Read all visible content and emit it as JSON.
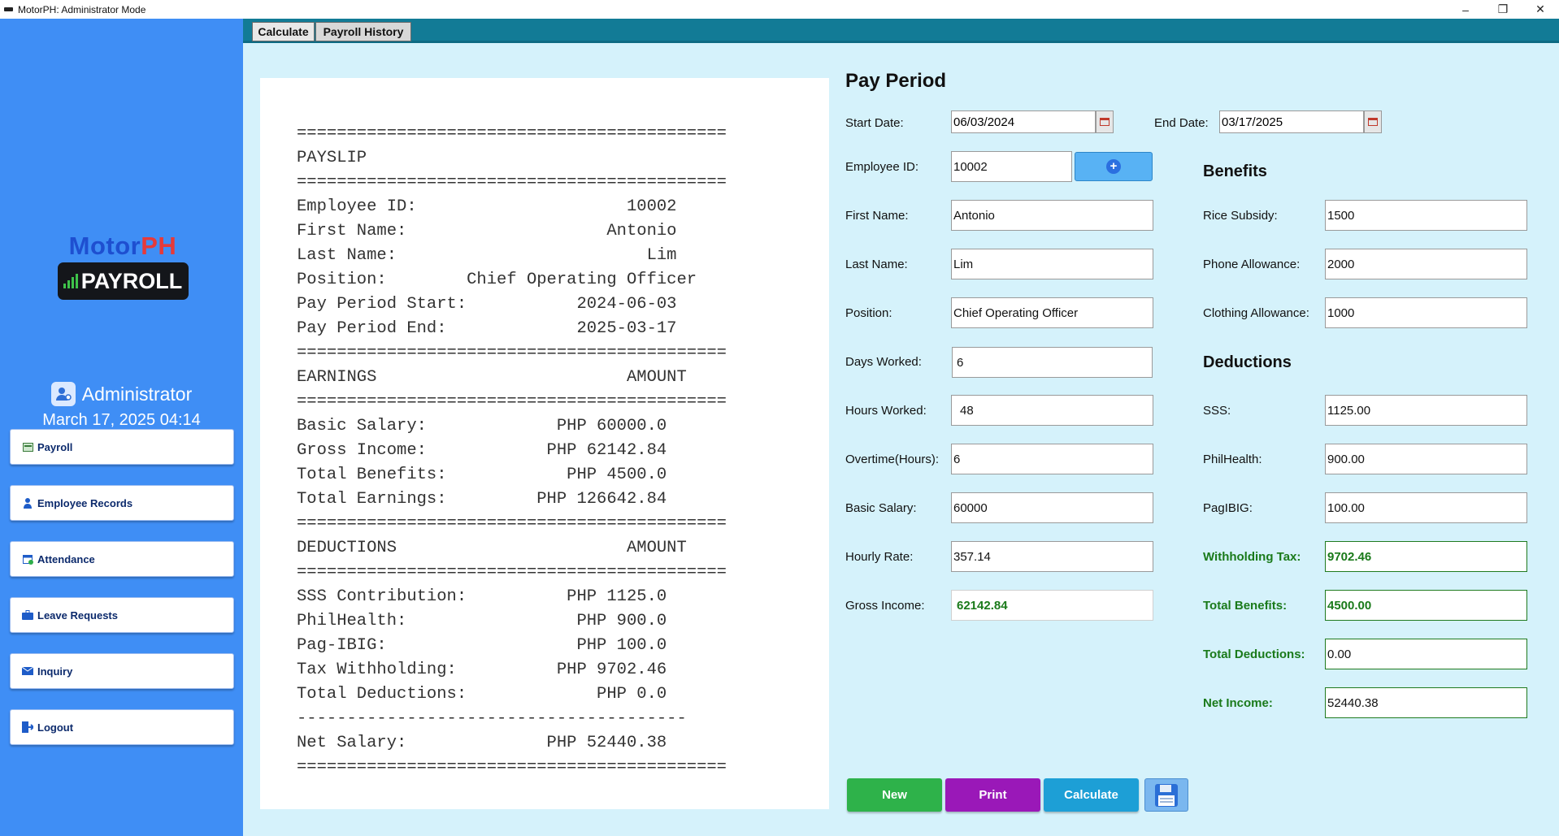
{
  "window": {
    "title": "MotorPH: Administrator Mode",
    "controls": {
      "minimize": "–",
      "restore": "❐",
      "close": "✕"
    }
  },
  "sidebar": {
    "logo_motor": "Motor",
    "logo_ph": "PH",
    "logo_payroll": "PAYROLL",
    "admin_name": "Administrator",
    "datetime": "March 17, 2025 04:14",
    "buttons": [
      {
        "label": "Payroll",
        "icon": "payroll-icon"
      },
      {
        "label": "Employee Records",
        "icon": "person-icon"
      },
      {
        "label": "Attendance",
        "icon": "calendar-check-icon"
      },
      {
        "label": "Leave Requests",
        "icon": "briefcase-icon"
      },
      {
        "label": "Inquiry",
        "icon": "mail-icon"
      },
      {
        "label": "Logout",
        "icon": "logout-icon"
      }
    ]
  },
  "tabs": [
    {
      "label": "Calculate",
      "active": true
    },
    {
      "label": "Payroll History",
      "active": false
    }
  ],
  "payslip": {
    "lines": [
      "===========================================",
      "PAYSLIP",
      "===========================================",
      "Employee ID:                     10002",
      "First Name:                    Antonio",
      "Last Name:                         Lim",
      "Position:        Chief Operating Officer",
      "Pay Period Start:           2024-06-03",
      "Pay Period End:             2025-03-17",
      "===========================================",
      "EARNINGS                         AMOUNT",
      "===========================================",
      "Basic Salary:             PHP 60000.0",
      "Gross Income:            PHP 62142.84",
      "Total Benefits:            PHP 4500.0",
      "Total Earnings:         PHP 126642.84",
      "===========================================",
      "DEDUCTIONS                       AMOUNT",
      "===========================================",
      "SSS Contribution:          PHP 1125.0",
      "PhilHealth:                 PHP 900.0",
      "Pag-IBIG:                   PHP 100.0",
      "Tax Withholding:          PHP 9702.46",
      "Total Deductions:             PHP 0.0",
      "---------------------------------------",
      "Net Salary:              PHP 52440.38",
      "==========================================="
    ]
  },
  "form": {
    "pay_period_title": "Pay Period",
    "start_date_label": "Start Date:",
    "start_date": "06/03/2024",
    "end_date_label": "End Date:",
    "end_date": "03/17/2025",
    "employee_id_label": "Employee ID:",
    "employee_id": "10002",
    "first_name_label": "First Name:",
    "first_name": "Antonio",
    "last_name_label": "Last Name:",
    "last_name": "Lim",
    "position_label": "Position:",
    "position": "Chief Operating Officer",
    "days_worked_label": "Days Worked:",
    "days_worked": "6",
    "hours_worked_label": "Hours Worked:",
    "hours_worked": "48",
    "overtime_label": "Overtime(Hours):",
    "overtime": "6",
    "basic_salary_label": "Basic Salary:",
    "basic_salary": "60000",
    "hourly_rate_label": "Hourly Rate:",
    "hourly_rate": "357.14",
    "gross_income_label": "Gross Income:",
    "gross_income": "62142.84"
  },
  "benefits": {
    "title": "Benefits",
    "rice_label": "Rice Subsidy:",
    "rice": "1500",
    "phone_label": "Phone Allowance:",
    "phone": "2000",
    "clothing_label": "Clothing Allowance:",
    "clothing": "1000"
  },
  "deductions": {
    "title": "Deductions",
    "sss_label": "SSS:",
    "sss": "1125.00",
    "philhealth_label": "PhilHealth:",
    "philhealth": "900.00",
    "pagibig_label": "PagIBIG:",
    "pagibig": "100.00",
    "withholding_label": "Withholding Tax:",
    "withholding": "9702.46",
    "total_benefits_label": "Total Benefits:",
    "total_benefits": "4500.00",
    "total_deductions_label": "Total Deductions:",
    "total_deductions": "0.00",
    "net_income_label": "Net Income:",
    "net_income": "52440.38"
  },
  "actions": {
    "new": "New",
    "print": "Print",
    "calculate": "Calculate"
  },
  "colors": {
    "sidebar": "#3f8ef5",
    "tabbar": "#127b96",
    "background": "#d5f2fb",
    "new_button": "#2eb24a",
    "print_button": "#9a18b8",
    "calculate_button": "#1d9fd6",
    "green_text": "#1a7a1a"
  }
}
